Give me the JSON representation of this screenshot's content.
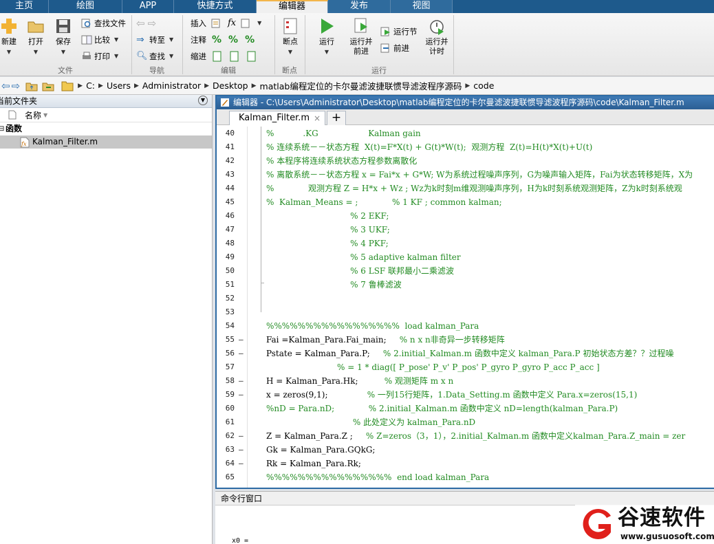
{
  "top_tabs": [
    {
      "label": "主页",
      "state": "normal"
    },
    {
      "label": "绘图",
      "state": "normal"
    },
    {
      "label": "APP",
      "state": "normal"
    },
    {
      "label": "快捷方式",
      "state": "normal"
    },
    {
      "label": "编辑器",
      "state": "active"
    },
    {
      "label": "发布",
      "state": "dim"
    },
    {
      "label": "视图",
      "state": "dim"
    }
  ],
  "ribbon": {
    "file": {
      "new": "新建",
      "open": "打开",
      "save": "保存",
      "find_files": "查找文件",
      "compare": "比较",
      "print": "打印",
      "group": "文件"
    },
    "nav": {
      "goto": "转至",
      "find": "查找",
      "group": "导航"
    },
    "edit": {
      "insert": "插入",
      "comment": "注释",
      "indent": "缩进",
      "fx": "fx",
      "group": "编辑"
    },
    "breakpoints": {
      "label": "断点",
      "group": "断点"
    },
    "run": {
      "run": "运行",
      "run_advance_1": "运行并",
      "run_advance_2": "前进",
      "run_section": "运行节",
      "advance": "前进",
      "run_time_1": "运行并",
      "run_time_2": "计时",
      "group": "运行"
    }
  },
  "address": [
    "C:",
    "Users",
    "Administrator",
    "Desktop",
    "matlab编程定位的卡尔曼滤波捷联惯导滤波程序源码",
    "code"
  ],
  "left_panel": {
    "title": "当前文件夹",
    "col_name": "名称",
    "group": "函数",
    "file": "Kalman_Filter.m"
  },
  "editor": {
    "title": "编辑器 - C:\\Users\\Administrator\\Desktop\\matlab编程定位的卡尔曼滤波捷联惯导滤波程序源码\\code\\Kalman_Filter.m",
    "tab": "Kalman_Filter.m",
    "tab_close": "×",
    "plus": "+"
  },
  "code_lines": [
    {
      "n": "40",
      "m": "",
      "t": "%           .KG                   Kalman gain",
      "c": "cmt"
    },
    {
      "n": "41",
      "m": "",
      "t": "% 连续系统－－状态方程  X(t)=F*X(t) + G(t)*W(t);  观测方程  Z(t)=H(t)*X(t)+U(t)",
      "c": "cmt"
    },
    {
      "n": "42",
      "m": "",
      "t": "% 本程序将连续系统状态方程参数离散化",
      "c": "cmt"
    },
    {
      "n": "43",
      "m": "",
      "t": "% 离散系统－－状态方程 x = Fai*x + G*W; W为系统过程噪声序列，G为噪声输入矩阵，Fai为状态转移矩阵，X为",
      "c": "cmt"
    },
    {
      "n": "44",
      "m": "",
      "t": "%             观测方程 Z = H*x + Wz ; Wz为k时刻m维观测噪声序列，H为k时刻系统观测矩阵，Z为k时刻系统观",
      "c": "cmt"
    },
    {
      "n": "45",
      "m": "",
      "t": "%  Kalman_Means = ;             % 1 KF ; common kalman;",
      "c": "cmt"
    },
    {
      "n": "46",
      "m": "",
      "t": "                                % 2 EKF;",
      "c": "cmt"
    },
    {
      "n": "47",
      "m": "",
      "t": "                                % 3 UKF;",
      "c": "cmt"
    },
    {
      "n": "48",
      "m": "",
      "t": "                                % 4 PKF;",
      "c": "cmt"
    },
    {
      "n": "49",
      "m": "",
      "t": "                                % 5 adaptive kalman filter",
      "c": "cmt"
    },
    {
      "n": "50",
      "m": "",
      "t": "                                % 6 LSF 联邦最小二乘滤波",
      "c": "cmt"
    },
    {
      "n": "51",
      "m": "",
      "t": "                                % 7 鲁棒滤波",
      "c": "cmt"
    },
    {
      "n": "52",
      "m": "",
      "t": "",
      "c": "cmt"
    },
    {
      "n": "53",
      "m": "",
      "t": "",
      "c": "cmt"
    },
    {
      "n": "54",
      "m": "",
      "t": "%%%%%%%%%%%%%%%%%  load kalman_Para",
      "c": "cmt"
    },
    {
      "n": "55",
      "m": "–",
      "t": "Fai =Kalman_Para.Fai_main;     % n x n非奇异一步转移矩阵",
      "c": "mix",
      "p": "Fai =Kalman_Para.Fai_main;     ",
      "r": "% n x n非奇异一步转移矩阵"
    },
    {
      "n": "56",
      "m": "–",
      "t": "Pstate = Kalman_Para.P;     % 2.initial_Kalman.m 函数中定义 kalman_Para.P 初始状态方差？？过程噪",
      "c": "mix",
      "p": "Pstate = Kalman_Para.P;     ",
      "r": "% 2.initial_Kalman.m 函数中定义 kalman_Para.P 初始状态方差？？过程噪"
    },
    {
      "n": "57",
      "m": "",
      "t": "                           % = 1 * diag([ P_pose' P_v' P_pos' P_gyro P_gyro P_acc P_acc ]",
      "c": "cmt"
    },
    {
      "n": "58",
      "m": "–",
      "t": "H = Kalman_Para.Hk;          % 观测矩阵 m x n",
      "c": "mix",
      "p": "H = Kalman_Para.Hk;          ",
      "r": "% 观测矩阵 m x n"
    },
    {
      "n": "59",
      "m": "–",
      "t": "x = zeros(9,1);               % 一列15行矩阵，1.Data_Setting.m 函数中定义 Para.x=zeros(15,1)",
      "c": "mix",
      "p": "x = zeros(9,1);               ",
      "r": "% 一列15行矩阵，1.Data_Setting.m 函数中定义 Para.x=zeros(15,1)"
    },
    {
      "n": "60",
      "m": "",
      "t": "%nD = Para.nD;             % 2.initial_Kalman.m 函数中定义 nD=length(kalman_Para.P)",
      "c": "cmt"
    },
    {
      "n": "61",
      "m": "",
      "t": "                                 % 此处定义为 kalman_Para.nD",
      "c": "cmt"
    },
    {
      "n": "62",
      "m": "–",
      "t": "Z = Kalman_Para.Z ;     % Z=zeros（3，1），2.initial_Kalman.m 函数中定义kalman_Para.Z_main = zer",
      "c": "mix",
      "p": "Z = Kalman_Para.Z ;     ",
      "r": "% Z=zeros（3，1），2.initial_Kalman.m 函数中定义kalman_Para.Z_main = zer"
    },
    {
      "n": "63",
      "m": "–",
      "t": "Gk = Kalman_Para.GQkG;",
      "c": "plain"
    },
    {
      "n": "64",
      "m": "–",
      "t": "Rk = Kalman_Para.Rk;",
      "c": "plain"
    },
    {
      "n": "65",
      "m": "",
      "t": "%%%%%%%%%%%%%%%%  end load kalman_Para",
      "c": "cmt"
    }
  ],
  "command_window": {
    "title": "命令行窗口",
    "prompt": "x0 ="
  },
  "watermark": {
    "name": "谷速软件",
    "url": "www.gusuosoft.com"
  },
  "colors": {
    "tab_blue": "#1e5a8c",
    "editor_border": "#2d6aa4",
    "comment_green": "#228b22",
    "watermark_red": "#e0201b"
  }
}
